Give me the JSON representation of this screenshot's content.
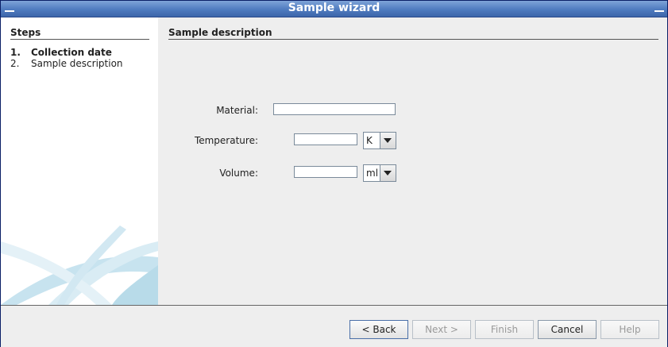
{
  "window": {
    "title": "Sample wizard"
  },
  "steps": {
    "heading": "Steps",
    "items": [
      {
        "number": "1.",
        "label": "Collection date",
        "active": true
      },
      {
        "number": "2.",
        "label": "Sample description",
        "active": false
      }
    ]
  },
  "page": {
    "title": "Sample description",
    "fields": {
      "material": {
        "label": "Material:",
        "value": ""
      },
      "temperature": {
        "label": "Temperature:",
        "value": "",
        "unit": "K"
      },
      "volume": {
        "label": "Volume:",
        "value": "",
        "unit": "ml"
      }
    }
  },
  "buttons": {
    "back": "< Back",
    "next": "Next >",
    "finish": "Finish",
    "cancel": "Cancel",
    "help": "Help"
  }
}
